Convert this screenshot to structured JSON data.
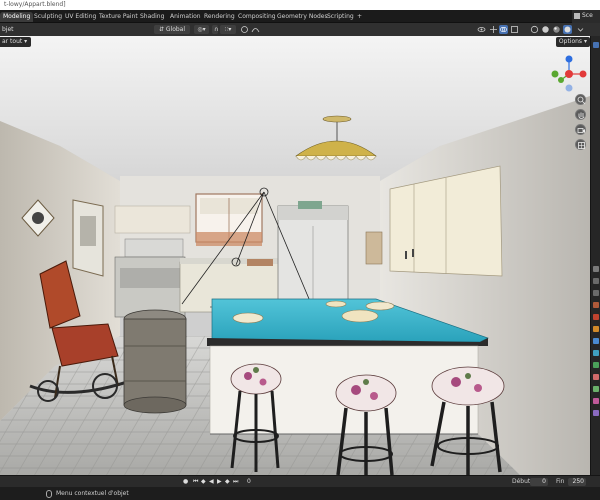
{
  "window": {
    "title": "t-lowy/Appart.blend]"
  },
  "menubar": {
    "tabs": [
      {
        "label": "Modeling"
      },
      {
        "label": "Sculpting"
      },
      {
        "label": "UV Editing"
      },
      {
        "label": "Texture Paint"
      },
      {
        "label": "Shading"
      },
      {
        "label": "Animation"
      },
      {
        "label": "Rendering"
      },
      {
        "label": "Compositing"
      },
      {
        "label": "Geometry Nodes"
      },
      {
        "label": "Scripting"
      },
      {
        "label": "+"
      }
    ],
    "scene_label": "Sce"
  },
  "header": {
    "mode_label": "bjet",
    "transform_orientation": "Global",
    "pivot_label": "▾",
    "snap_label": "▾"
  },
  "subheader": {
    "add_label": "ar tout",
    "options_label": "Options"
  },
  "timeline": {
    "start_label": "Début",
    "start_value": "0",
    "end_label": "Fin",
    "end_value": "250",
    "current_frame": "0"
  },
  "statusbar": {
    "message": "Menu contextuel d'objet"
  },
  "colors": {
    "accent_blue": "#4772b3",
    "counter_top": "#3bb3c9",
    "axis_x": "#e23a3a",
    "axis_y": "#5aa830",
    "axis_z": "#2d6ee0"
  }
}
